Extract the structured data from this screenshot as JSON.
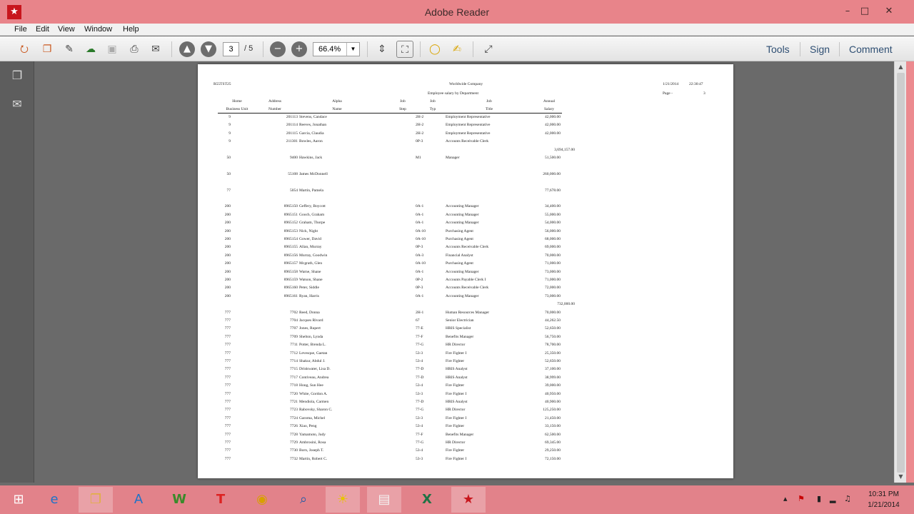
{
  "window": {
    "title": "Adobe Reader",
    "app_icon": "acrobat-icon"
  },
  "menu": [
    "File",
    "Edit",
    "View",
    "Window",
    "Help"
  ],
  "toolbar": {
    "page_current": "3",
    "page_total": "/ 5",
    "zoom": "66.4%",
    "tools_label": "Tools",
    "sign_label": "Sign",
    "comment_label": "Comment"
  },
  "report": {
    "report_id": "R55TST25",
    "company": "Worldwide Company",
    "subtitle": "Employee salary by Department",
    "date": "1/21/2014",
    "time": "22:30:47",
    "page_label": "Page -",
    "page_number": "3",
    "headers": [
      [
        "Home",
        "Business Unit"
      ],
      [
        "Address",
        "Number"
      ],
      [
        "Alpha",
        "Name"
      ],
      [
        "Job",
        "Step"
      ],
      [
        "Job",
        "Typ"
      ],
      [
        "Job",
        "Title"
      ],
      [
        "Annual",
        "Salary"
      ]
    ],
    "rows": [
      {
        "bu": "9",
        "num": "201113",
        "name": "Stevens, Candace",
        "step": "",
        "typ": "2H-2",
        "title": "Employment Representative",
        "salary": "42,000.00"
      },
      {
        "bu": "9",
        "num": "201114",
        "name": "Reeves, Jonathan",
        "step": "",
        "typ": "2H-2",
        "title": "Employment Representative",
        "salary": "42,000.00"
      },
      {
        "bu": "9",
        "num": "201115",
        "name": "Garcia, Claudia",
        "step": "",
        "typ": "2H-2",
        "title": "Employment Representative",
        "salary": "42,000.00"
      },
      {
        "bu": "9",
        "num": "211301",
        "name": "Bowles, Aaron",
        "step": "",
        "typ": "0P-3",
        "title": "Accounts Receivable Clerk",
        "salary": ""
      },
      {
        "total": "3,694,157.00"
      },
      {
        "bu": "50",
        "num": "9400",
        "name": "Hawkins, Jack",
        "step": "",
        "typ": "M1",
        "title": "Manager",
        "salary": "51,500.00"
      },
      {
        "gap": true
      },
      {
        "bu": "50",
        "num": "55108",
        "name": "James McDonnell",
        "step": "",
        "typ": "",
        "title": "",
        "salary": "260,000.00"
      },
      {
        "gap": true
      },
      {
        "bu": "77",
        "num": "5054",
        "name": "Martin, Pamela",
        "step": "",
        "typ": "",
        "title": "",
        "salary": "77,678.00"
      },
      {
        "gap": true
      },
      {
        "bu": "200",
        "num": "8965150",
        "name": "Geffery, Boycott",
        "step": "",
        "typ": "0A-1",
        "title": "Accounting Manager",
        "salary": "34,400.00"
      },
      {
        "bu": "200",
        "num": "8965151",
        "name": "Gooch, Graham",
        "step": "",
        "typ": "0A-1",
        "title": "Accounting Manager",
        "salary": "55,000.00"
      },
      {
        "bu": "200",
        "num": "8965152",
        "name": "Graham, Thorpe",
        "step": "",
        "typ": "0A-1",
        "title": "Accounting Manager",
        "salary": "54,000.00"
      },
      {
        "bu": "200",
        "num": "8965153",
        "name": "Nick, Night",
        "step": "",
        "typ": "0A-10",
        "title": "Purchasing Agent",
        "salary": "56,000.00"
      },
      {
        "bu": "200",
        "num": "8965154",
        "name": "Gower, David",
        "step": "",
        "typ": "0A-10",
        "title": "Purchasing Agent",
        "salary": "68,000.00"
      },
      {
        "bu": "200",
        "num": "8965155",
        "name": "Allan, Murray",
        "step": "",
        "typ": "0P-3",
        "title": "Accounts Receivable Clerk",
        "salary": "69,000.00"
      },
      {
        "bu": "200",
        "num": "8965156",
        "name": "Murray, Goodwin",
        "step": "",
        "typ": "0A-3",
        "title": "Financial Analyst",
        "salary": "70,000.00"
      },
      {
        "bu": "200",
        "num": "8965157",
        "name": "Mcgrath, Glen",
        "step": "",
        "typ": "0A-10",
        "title": "Purchasing Agent",
        "salary": "71,000.00"
      },
      {
        "bu": "200",
        "num": "8965158",
        "name": "Warne, Shane",
        "step": "",
        "typ": "0A-1",
        "title": "Accounting Manager",
        "salary": "73,000.00"
      },
      {
        "bu": "200",
        "num": "8965159",
        "name": "Watson, Shane",
        "step": "",
        "typ": "0P-2",
        "title": "Accounts Payable Clerk I",
        "salary": "71,000.00"
      },
      {
        "bu": "200",
        "num": "8965160",
        "name": "Peter, Siddle",
        "step": "",
        "typ": "0P-3",
        "title": "Accounts Receivable Clerk",
        "salary": "72,000.00"
      },
      {
        "bu": "200",
        "num": "8965161",
        "name": "Ryan, Harris",
        "step": "",
        "typ": "0A-1",
        "title": "Accounting Manager",
        "salary": "73,000.00"
      },
      {
        "total": "732,000.00"
      },
      {
        "bu": "777",
        "num": "7702",
        "name": "Reed, Donna",
        "step": "",
        "typ": "2H-1",
        "title": "Human Resources Manager",
        "salary": "70,000.00"
      },
      {
        "bu": "777",
        "num": "7704",
        "name": "Jacques Rivard",
        "step": "",
        "typ": "67",
        "title": "Senior Electrician",
        "salary": "44,262.50"
      },
      {
        "bu": "777",
        "num": "7707",
        "name": "Jones, Rupert",
        "step": "",
        "typ": "77-E",
        "title": "HRIS Specialist",
        "salary": "52,650.00"
      },
      {
        "bu": "777",
        "num": "7709",
        "name": "Shelton, Lynda",
        "step": "",
        "typ": "77-F",
        "title": "Benefits Manager",
        "salary": "56,750.00"
      },
      {
        "bu": "777",
        "num": "7711",
        "name": "Potter, Brenda L.",
        "step": "",
        "typ": "77-G",
        "title": "HR Director",
        "salary": "78,700.00"
      },
      {
        "bu": "777",
        "num": "7712",
        "name": "Levesque, Gaetan",
        "step": "",
        "typ": "53-3",
        "title": "Fire Fighter I",
        "salary": "25,350.00"
      },
      {
        "bu": "777",
        "num": "7714",
        "name": "Shakur, Abdul J.",
        "step": "",
        "typ": "53-4",
        "title": "Fire Fighter",
        "salary": "52,650.00"
      },
      {
        "bu": "777",
        "num": "7715",
        "name": "Drinkwater, Lisa D.",
        "step": "",
        "typ": "77-D",
        "title": "HRIS Analyst",
        "salary": "37,100.00"
      },
      {
        "bu": "777",
        "num": "7717",
        "name": "Contiveau, Andrea",
        "step": "",
        "typ": "77-D",
        "title": "HRIS Analyst",
        "salary": "38,999.00"
      },
      {
        "bu": "777",
        "num": "7718",
        "name": "Hong, Sun Hee",
        "step": "",
        "typ": "53-4",
        "title": "Fire Fighter",
        "salary": "39,000.00"
      },
      {
        "bu": "777",
        "num": "7720",
        "name": "White, Gordon A.",
        "step": "",
        "typ": "53-3",
        "title": "Fire Fighter I",
        "salary": "40,950.00"
      },
      {
        "bu": "777",
        "num": "7721",
        "name": "Mendiola, Carmen",
        "step": "",
        "typ": "77-D",
        "title": "HRIS Analyst",
        "salary": "40,900.00"
      },
      {
        "bu": "777",
        "num": "7723",
        "name": "Rabovsky, Sharon C.",
        "step": "",
        "typ": "77-G",
        "title": "HR Director",
        "salary": "125,250.00"
      },
      {
        "bu": "777",
        "num": "7724",
        "name": "Garoma, Michel",
        "step": "",
        "typ": "53-3",
        "title": "Fire Fighter I",
        "salary": "21,450.00"
      },
      {
        "bu": "777",
        "num": "7726",
        "name": "Xiao, Peng",
        "step": "",
        "typ": "53-4",
        "title": "Fire Fighter",
        "salary": "33,150.00"
      },
      {
        "bu": "777",
        "num": "7728",
        "name": "Yamamoto, Judy",
        "step": "",
        "typ": "77-F",
        "title": "Benefits Manager",
        "salary": "62,500.00"
      },
      {
        "bu": "777",
        "num": "7729",
        "name": "Ambrosini, Rosa",
        "step": "",
        "typ": "77-G",
        "title": "HR Director",
        "salary": "69,345.00"
      },
      {
        "bu": "777",
        "num": "7730",
        "name": "Born, Joseph T.",
        "step": "",
        "typ": "53-4",
        "title": "Fire Fighter",
        "salary": "29,250.00"
      },
      {
        "bu": "777",
        "num": "7732",
        "name": "Martin, Robert C.",
        "step": "",
        "typ": "53-3",
        "title": "Fire Fighter I",
        "salary": "72,150.00"
      }
    ]
  },
  "taskbar": {
    "apps": [
      "windows-start-icon",
      "internet-explorer-icon",
      "file-explorer-icon",
      "app-store-icon",
      "word-icon",
      "t-app-icon",
      "chrome-icon",
      "search-app-icon",
      "bulb-icon",
      "folder-icon",
      "excel-icon",
      "acrobat-icon"
    ],
    "time": "10:31 PM",
    "date": "1/21/2014"
  }
}
